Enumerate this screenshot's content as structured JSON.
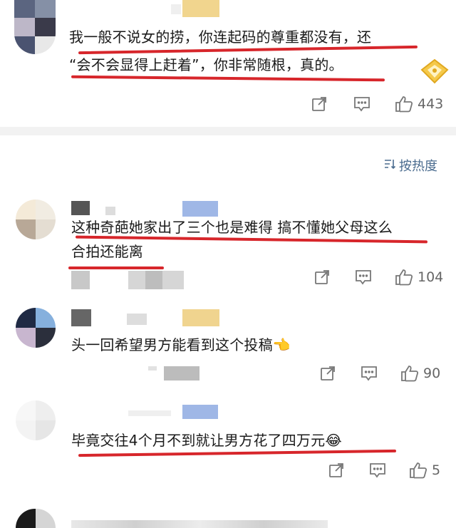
{
  "comments": [
    {
      "text_lines": [
        "我一般不说女的捞，你连起码的尊重都没有，还",
        "“会不会显得上赶着”，你非常随根，真的。"
      ],
      "likes": "443"
    },
    {
      "text_lines": [
        "这种奇葩她家出了三个也是难得 搞不懂她父母这么",
        "合拍还能离"
      ],
      "likes": "104"
    },
    {
      "text_lines": [
        "头一回希望男方能看到这个投稿👈"
      ],
      "likes": "90"
    },
    {
      "text_lines": [
        "毕竟交往4个月不到就让男方花了四万元😂"
      ],
      "likes": "5"
    }
  ],
  "sort": {
    "label": "按热度",
    "icon": "sort-icon"
  },
  "colors": {
    "underline": "#d7262b",
    "sort_text": "#4b6c8f",
    "action_icon": "#777777"
  }
}
